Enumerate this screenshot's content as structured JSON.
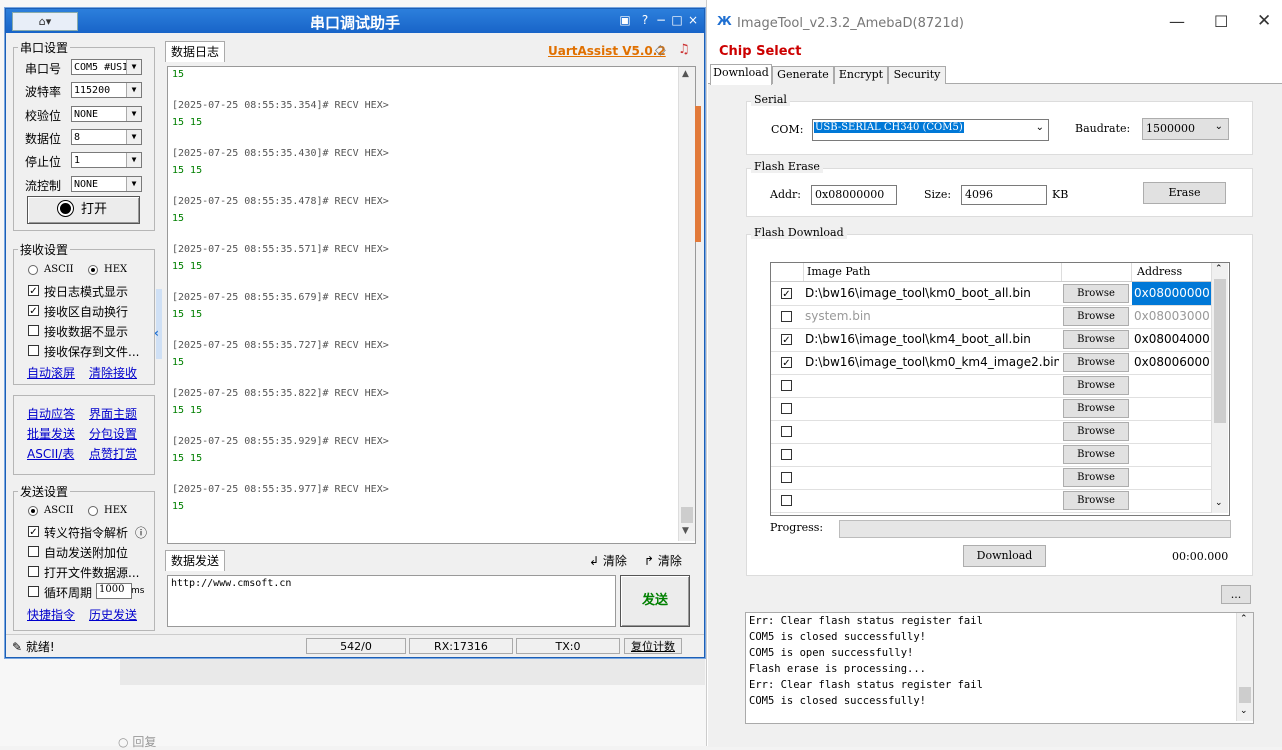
{
  "background": {
    "reply_label": "回复"
  },
  "uart": {
    "title": "串口调试助手",
    "brand": "UartAssist V5.0.2",
    "port_group": "串口设置",
    "port_fields": [
      {
        "label": "串口号",
        "value": "COM5 #USI"
      },
      {
        "label": "波特率",
        "value": "115200"
      },
      {
        "label": "校验位",
        "value": "NONE"
      },
      {
        "label": "数据位",
        "value": "8"
      },
      {
        "label": "停止位",
        "value": "1"
      },
      {
        "label": "流控制",
        "value": "NONE"
      }
    ],
    "open_button": "打开",
    "recv_group": "接收设置",
    "recv_mode": {
      "ascii": "ASCII",
      "hex": "HEX",
      "selected": "HEX"
    },
    "recv_options": [
      {
        "label": "按日志模式显示",
        "checked": true
      },
      {
        "label": "接收区自动换行",
        "checked": true
      },
      {
        "label": "接收数据不显示",
        "checked": false
      },
      {
        "label": "接收保存到文件...",
        "checked": false
      }
    ],
    "recv_links": [
      "自动滚屏",
      "清除接收"
    ],
    "tool_links": [
      [
        "自动应答",
        "界面主题"
      ],
      [
        "批量发送",
        "分包设置"
      ],
      [
        "ASCII/表",
        "点赞打赏"
      ]
    ],
    "send_group": "发送设置",
    "send_mode": {
      "ascii": "ASCII",
      "hex": "HEX",
      "selected": "ASCII"
    },
    "send_options": [
      {
        "label": "转义符指令解析",
        "checked": true,
        "info": "ⓘ"
      },
      {
        "label": "自动发送附加位",
        "checked": false
      },
      {
        "label": "打开文件数据源...",
        "checked": false
      },
      {
        "label": "循环周期",
        "checked": false,
        "period": "1000",
        "unit": "ms"
      }
    ],
    "send_links": [
      "快捷指令",
      "历史发送"
    ],
    "log_tab": "数据日志",
    "log": [
      {
        "ts": "",
        "hex": "15"
      },
      {
        "ts": "[2025-07-25 08:55:35.354]# RECV HEX>",
        "hex": "15 15"
      },
      {
        "ts": "[2025-07-25 08:55:35.430]# RECV HEX>",
        "hex": "15 15"
      },
      {
        "ts": "[2025-07-25 08:55:35.478]# RECV HEX>",
        "hex": "15"
      },
      {
        "ts": "[2025-07-25 08:55:35.571]# RECV HEX>",
        "hex": "15 15"
      },
      {
        "ts": "[2025-07-25 08:55:35.679]# RECV HEX>",
        "hex": "15 15"
      },
      {
        "ts": "[2025-07-25 08:55:35.727]# RECV HEX>",
        "hex": "15"
      },
      {
        "ts": "[2025-07-25 08:55:35.822]# RECV HEX>",
        "hex": "15 15"
      },
      {
        "ts": "[2025-07-25 08:55:35.929]# RECV HEX>",
        "hex": "15 15"
      },
      {
        "ts": "[2025-07-25 08:55:35.977]# RECV HEX>",
        "hex": "15"
      }
    ],
    "send_tab": "数据发送",
    "clear1": "清除",
    "clear2": "清除",
    "send_text": "http://www.cmsoft.cn",
    "send_button": "发送",
    "status": {
      "ready": "就绪!",
      "count": "542/0",
      "rx": "RX:17316",
      "tx": "TX:0",
      "reset": "复位计数"
    }
  },
  "imagetool": {
    "title": "ImageTool_v2.3.2_AmebaD(8721d)",
    "chip_select": "Chip Select",
    "tabs": [
      "Download",
      "Generate",
      "Encrypt",
      "Security"
    ],
    "active_tab": "Download",
    "serial": {
      "legend": "Serial",
      "com_label": "COM:",
      "com_value": "USB-SERIAL CH340 (COM5)",
      "baud_label": "Baudrate:",
      "baud_value": "1500000"
    },
    "erase": {
      "legend": "Flash Erase",
      "addr_label": "Addr:",
      "addr_value": "0x08000000",
      "size_label": "Size:",
      "size_value": "4096",
      "size_unit": "KB",
      "button": "Erase"
    },
    "download": {
      "legend": "Flash Download",
      "col_path": "Image Path",
      "col_addr": "Address",
      "rows": [
        {
          "checked": true,
          "path": "D:\\bw16\\image_tool\\km0_boot_all.bin",
          "browse": "Browse",
          "addr": "0x08000000",
          "selected": true,
          "disabled": false
        },
        {
          "checked": false,
          "path": "system.bin",
          "browse": "Browse",
          "addr": "0x08003000",
          "selected": false,
          "disabled": true
        },
        {
          "checked": true,
          "path": "D:\\bw16\\image_tool\\km4_boot_all.bin",
          "browse": "Browse",
          "addr": "0x08004000",
          "selected": false,
          "disabled": false
        },
        {
          "checked": true,
          "path": "D:\\bw16\\image_tool\\km0_km4_image2.bin",
          "browse": "Browse",
          "addr": "0x08006000",
          "selected": false,
          "disabled": false
        },
        {
          "checked": false,
          "path": "",
          "browse": "Browse",
          "addr": "",
          "selected": false,
          "disabled": false
        },
        {
          "checked": false,
          "path": "",
          "browse": "Browse",
          "addr": "",
          "selected": false,
          "disabled": false
        },
        {
          "checked": false,
          "path": "",
          "browse": "Browse",
          "addr": "",
          "selected": false,
          "disabled": false
        },
        {
          "checked": false,
          "path": "",
          "browse": "Browse",
          "addr": "",
          "selected": false,
          "disabled": false
        },
        {
          "checked": false,
          "path": "",
          "browse": "Browse",
          "addr": "",
          "selected": false,
          "disabled": false
        },
        {
          "checked": false,
          "path": "",
          "browse": "Browse",
          "addr": "",
          "selected": false,
          "disabled": false
        }
      ],
      "progress_label": "Progress:",
      "progress": 0,
      "button": "Download",
      "elapsed": "00:00.000"
    },
    "more_button": "...",
    "console": [
      "Err: Clear flash status register fail",
      "COM5 is closed successfully!",
      "COM5 is open successfully!",
      "Flash erase is processing...",
      "Err: Clear flash status register fail",
      "COM5 is closed successfully!"
    ],
    "colors": {
      "chip_select": "#cc0000",
      "selection": "#0078d7",
      "title_bar": "#1f6fd1"
    }
  }
}
